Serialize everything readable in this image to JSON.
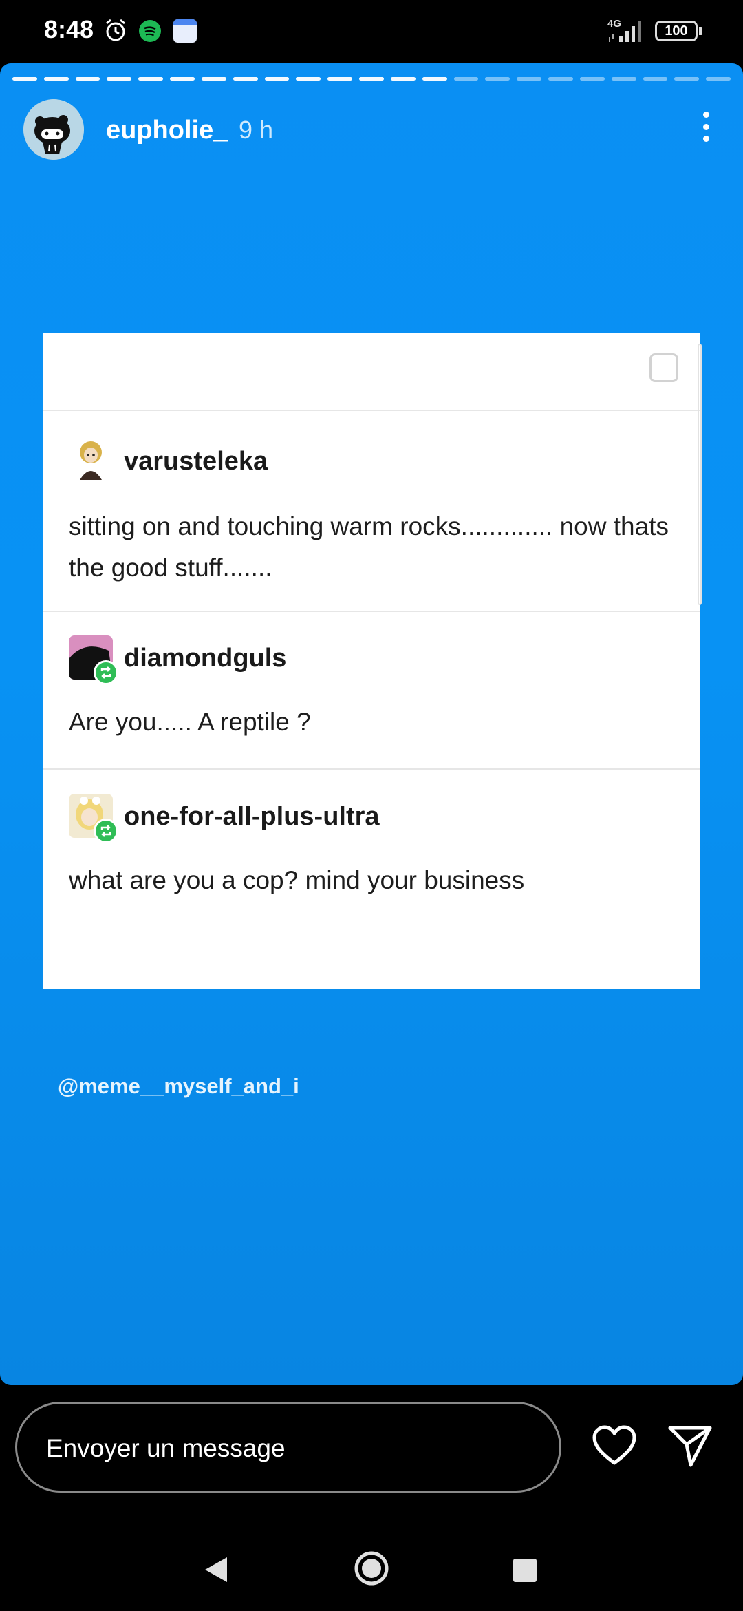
{
  "status_bar": {
    "time": "8:48",
    "network": "4G",
    "battery": "100",
    "icons": [
      "alarm-icon",
      "spotify-icon",
      "calendar-icon",
      "signal-icon",
      "battery-icon"
    ]
  },
  "story": {
    "progress": {
      "segments_total": 23,
      "segments_viewed": 14
    },
    "username": "eupholie_",
    "time_ago": "9 h",
    "background_color": "#0a8ff3",
    "mention": "@meme__myself_and_i"
  },
  "card": {
    "posts": [
      {
        "username": "varusteleka",
        "text": "sitting on and touching warm rocks............. now thats the good stuff.......",
        "reblog": false
      },
      {
        "username": "diamondguls",
        "text": "Are you..... A  reptile ?",
        "reblog": true
      },
      {
        "username": "one-for-all-plus-ultra",
        "text": "what are you a cop? mind your business",
        "reblog": true
      }
    ]
  },
  "reply_bar": {
    "placeholder": "Envoyer un message",
    "icons": [
      "heart-icon",
      "send-icon"
    ]
  },
  "nav_bar": {
    "icons": [
      "back-icon",
      "home-icon",
      "recents-icon"
    ]
  },
  "colors": {
    "story_blue": "#0a8ff3",
    "reblog_green": "#2fbd56"
  }
}
